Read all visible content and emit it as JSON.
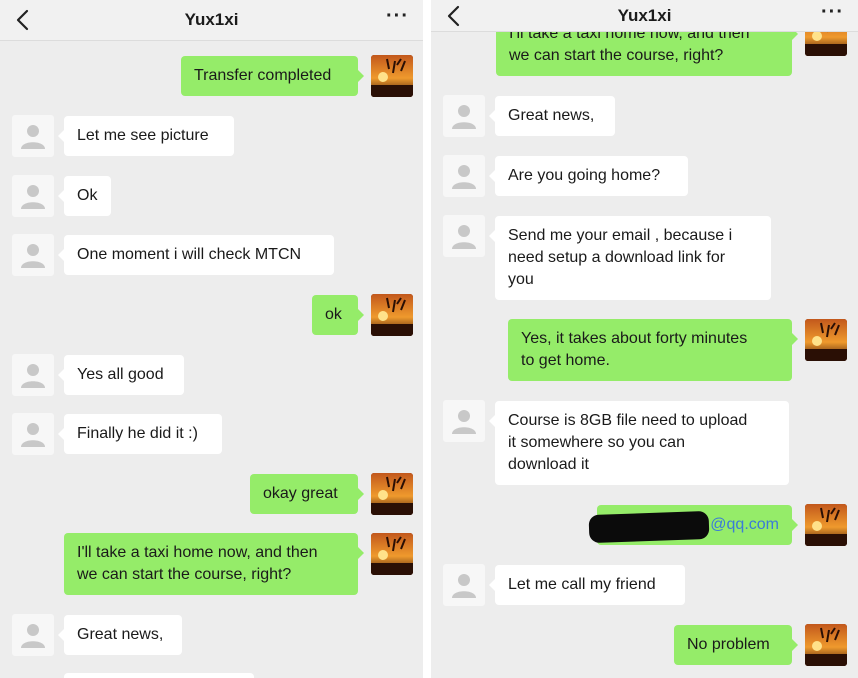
{
  "chat_title": "Yux1xi",
  "more_label": "···",
  "left_messages": [
    {
      "from": "me",
      "text": "Transfer completed"
    },
    {
      "from": "them",
      "text": "Let me see picture"
    },
    {
      "from": "them",
      "text": "Ok"
    },
    {
      "from": "them",
      "text": "One moment i will check MTCN"
    },
    {
      "from": "me",
      "text": "ok"
    },
    {
      "from": "them",
      "text": "Yes all good"
    },
    {
      "from": "them",
      "text": "Finally he did it :)"
    },
    {
      "from": "me",
      "text": "okay great"
    },
    {
      "from": "me",
      "text_line1": "I'll take a taxi home now, and then",
      "text_line2": "we can start the course, right?"
    },
    {
      "from": "them",
      "text": "Great news,"
    }
  ],
  "right_messages": [
    {
      "from": "me",
      "text_line1": "I'll take a taxi home now, and then",
      "text_line2": "we can start the course, right?"
    },
    {
      "from": "them",
      "text": "Great news,"
    },
    {
      "from": "them",
      "text": "Are you going home?"
    },
    {
      "from": "them",
      "text_line1": "Send me your email , because i",
      "text_line2": "need setup a download link for",
      "text_line3": "you"
    },
    {
      "from": "me",
      "text_line1": "Yes, it takes about forty minutes",
      "text_line2": "to get home."
    },
    {
      "from": "them",
      "text_line1": "Course is 8GB file need to upload",
      "text_line2": "it somewhere so you can",
      "text_line3": "download it"
    },
    {
      "from": "me",
      "text": "@qq.com"
    },
    {
      "from": "them",
      "text": "Let me call my friend"
    },
    {
      "from": "me",
      "text": "No problem"
    }
  ],
  "colors": {
    "outgoing_bubble": "#95ec69",
    "incoming_bubble": "#ffffff",
    "chat_background": "#ededed",
    "link": "#3b7bd8"
  },
  "icons": {
    "back": "chevron-left-icon",
    "more": "more-dots-icon",
    "default_avatar": "default-avatar-icon"
  }
}
